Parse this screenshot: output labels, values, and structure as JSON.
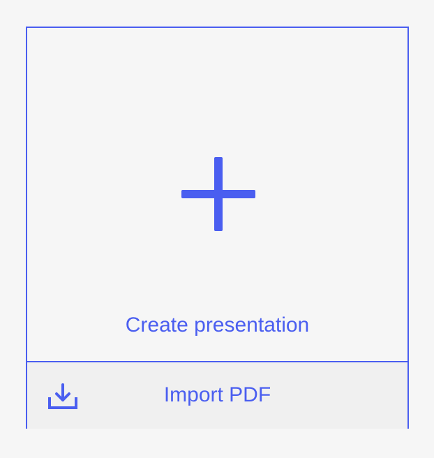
{
  "card": {
    "create_label": "Create presentation",
    "create_icon": "plus-icon",
    "import_label": "Import PDF",
    "import_icon": "download-icon"
  },
  "colors": {
    "accent": "#4a5ef0",
    "background": "#f6f6f6",
    "import_background": "#f0f0f0"
  }
}
